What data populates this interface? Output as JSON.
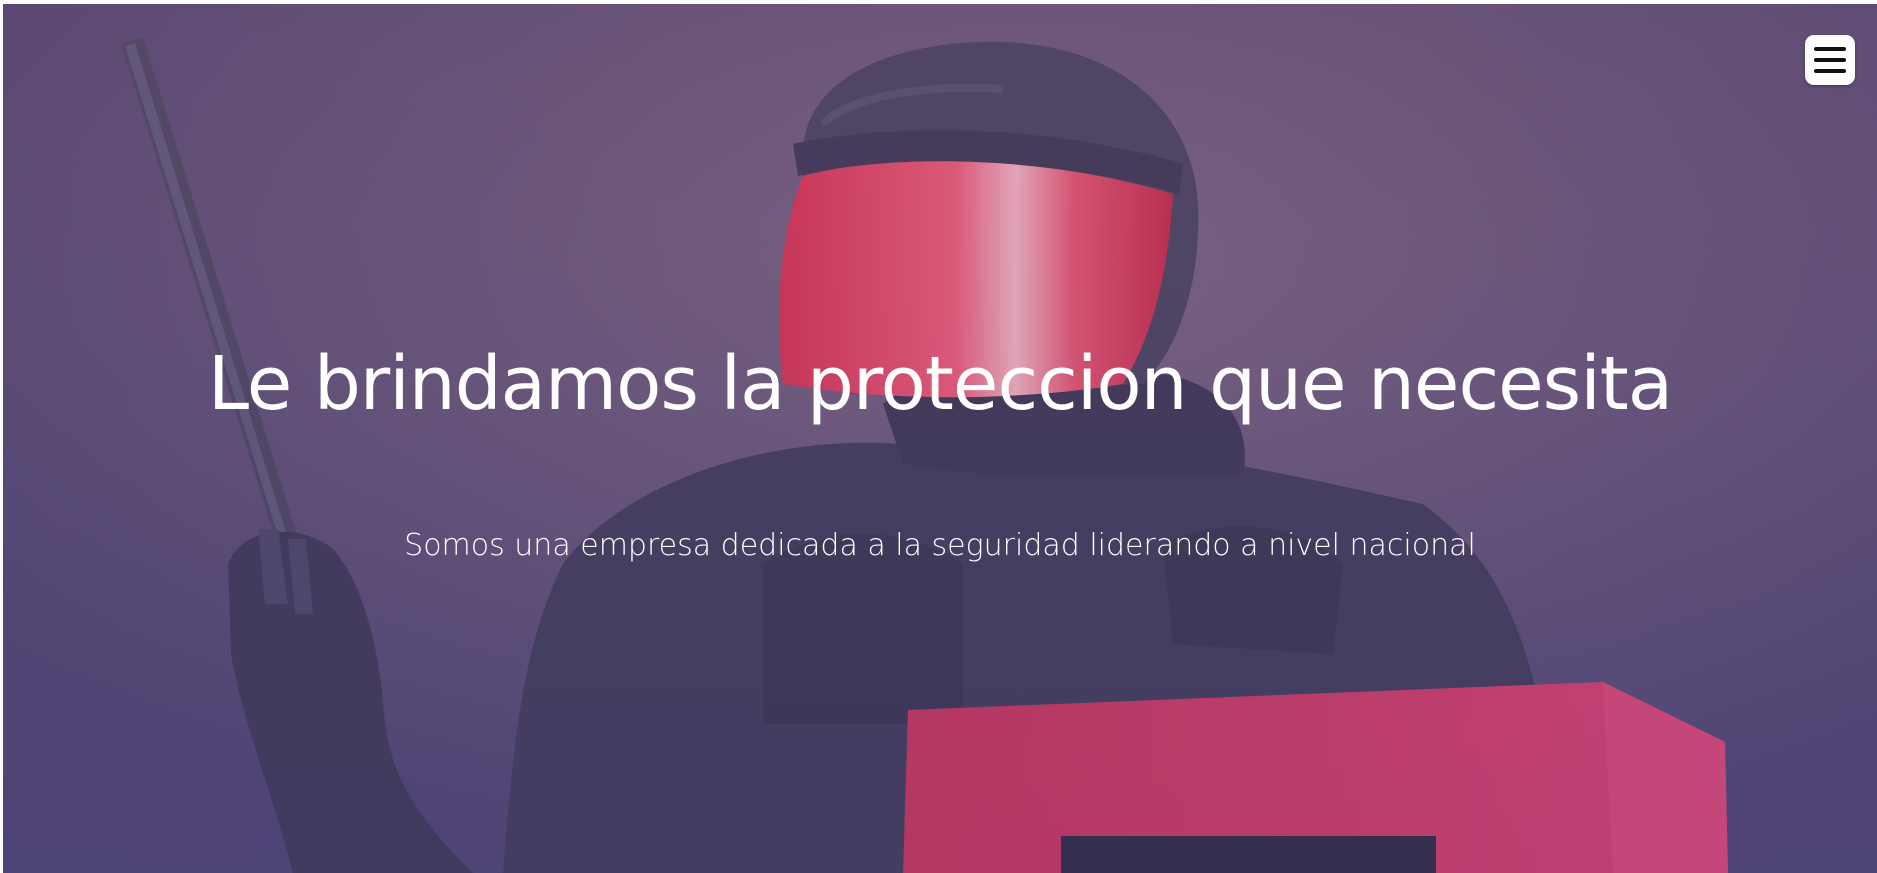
{
  "hero": {
    "title": "Le brindamos la proteccion que necesita",
    "subtitle": "Somos una empresa dedicada a la seguridad liderando a nivel nacional",
    "background_image": "riot-police-officer-photo",
    "overlay_color": "#6a4e7a"
  },
  "header": {
    "menu_icon": "hamburger-menu-icon"
  },
  "colors": {
    "accent_red": "#e0325e",
    "text": "#ffffff"
  }
}
